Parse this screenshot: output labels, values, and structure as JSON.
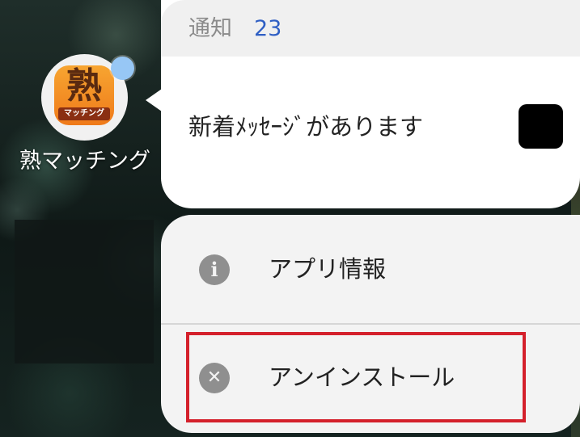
{
  "app": {
    "name": "熟マッチング",
    "icon_kanji": "熟",
    "icon_tag": "マッチング",
    "icon_name": "jyuku-matching-app-icon",
    "badge_color": "#97c7f5"
  },
  "notification": {
    "title": "通知",
    "count": "23",
    "message": "新着ﾒｯｾｰｼﾞがあります",
    "count_color": "#2f5fc4"
  },
  "menu": {
    "items": [
      {
        "label": "アプリ情報",
        "icon": "info-icon",
        "glyph": "i"
      },
      {
        "label": "アンインストール",
        "icon": "close-circle-icon",
        "glyph": "✕"
      }
    ],
    "highlight_color": "#d4202b"
  }
}
